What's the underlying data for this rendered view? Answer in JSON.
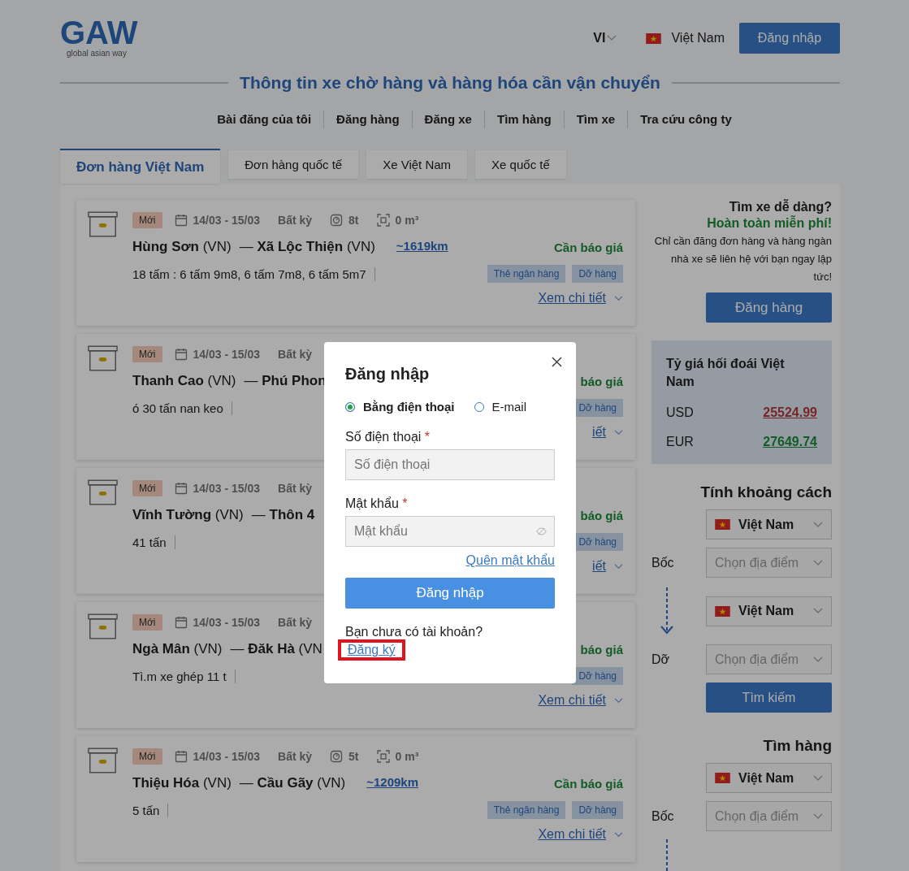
{
  "logo": {
    "name": "GAW",
    "tagline": "global asian way"
  },
  "header": {
    "language": "VI",
    "country": "Việt Nam",
    "login_button": "Đăng nhập"
  },
  "page_title": "Thông tin xe chờ hàng và hàng hóa cần vận chuyển",
  "nav": [
    "Bài đăng của tôi",
    "Đăng hàng",
    "Đăng xe",
    "Tìm hàng",
    "Tìm xe",
    "Tra cứu công ty"
  ],
  "tabs": [
    {
      "label": "Đơn hàng Việt Nam",
      "selected": true
    },
    {
      "label": "Đơn hàng quốc tế",
      "selected": false
    },
    {
      "label": "Xe Việt Nam",
      "selected": false
    },
    {
      "label": "Xe quốc tế",
      "selected": false
    }
  ],
  "orders": [
    {
      "badge": "Mới",
      "date": "14/03 - 15/03",
      "time": "Bất kỳ",
      "weight": "8t",
      "volume": "0 m³",
      "from": "Hùng Sơn",
      "from_country": "(VN)",
      "dash": "—",
      "to": "Xã Lộc Thiện",
      "to_country": "(VN)",
      "distance": "~1619km",
      "price": "Cần báo giá",
      "cargo": "18 tấm : 6 tấm 9m8, 6 tấm 7m8, 6 tấm 5m7",
      "tags": [
        "Thẻ ngân hàng",
        "Dỡ hàng"
      ],
      "details_link": "Xem chi tiết"
    },
    {
      "badge": "Mới",
      "date": "14/03 - 15/03",
      "time": "Bất kỳ",
      "from": "Thanh Cao",
      "from_country": "(VN)",
      "dash": "—",
      "to": "Phú Phon",
      "price": "báo giá",
      "cargo": "ó 30 tấn nan keo",
      "tags": [
        "Dỡ hàng"
      ],
      "details_link": "iết"
    },
    {
      "badge": "Mới",
      "date": "14/03 - 15/03",
      "time": "Bất kỳ",
      "from": "Vĩnh Tường",
      "from_country": "(VN)",
      "dash": "—",
      "to": "Thôn 4",
      "price": "báo giá",
      "cargo": "41 tấn",
      "tags": [
        "Dỡ hàng"
      ],
      "details_link": "iết"
    },
    {
      "badge": "Mới",
      "date": "14/03 - 15/03",
      "time": "Bất kỳ",
      "from": "Ngà Mân",
      "from_country": "(VN)",
      "dash": "—",
      "to": "Đăk Hà",
      "to_country": "(VN",
      "price": "báo giá",
      "cargo": "Tì.m xe ghép 11 t",
      "tags": [
        "Dỡ hàng"
      ],
      "details_link": "Xem chi tiết"
    },
    {
      "badge": "Mới",
      "date": "14/03 - 15/03",
      "time": "Bất kỳ",
      "weight": "5t",
      "volume": "0 m³",
      "from": "Thiệu Hóa",
      "from_country": "(VN)",
      "dash": "—",
      "to": "Cầu Gãy",
      "to_country": "(VN)",
      "distance": "~1209km",
      "price": "Cần báo giá",
      "cargo": "5 tấn",
      "tags": [
        "Thẻ ngân hàng",
        "Dỡ hàng"
      ],
      "details_link": "Xem chi tiết"
    }
  ],
  "promo": {
    "title": "Tìm xe dễ dàng?",
    "highlight": "Hoàn toàn miễn phí!",
    "text": "Chỉ cần đăng đơn hàng và hàng ngàn nhà xe sẽ liên hệ với bạn ngay lập tức!",
    "button": "Đăng hàng"
  },
  "exchange": {
    "title": "Tỷ giá hối đoái Việt Nam",
    "rates": [
      {
        "currency": "USD",
        "value": "25524.99",
        "kind": "down"
      },
      {
        "currency": "EUR",
        "value": "27649.74",
        "kind": "up"
      }
    ]
  },
  "distance": {
    "title": "Tính khoảng cách",
    "pickup_label": "Bốc",
    "drop_label": "Dỡ",
    "pickup_country": "Việt Nam",
    "pickup_placeholder": "Chọn địa điểm",
    "drop_country": "Việt Nam",
    "drop_placeholder": "Chọn địa điểm",
    "button": "Tìm kiếm"
  },
  "find_goods": {
    "title": "Tìm hàng",
    "country": "Việt Nam",
    "label": "Bốc",
    "placeholder": "Chọn địa điểm"
  },
  "login": {
    "title": "Đăng nhập",
    "methods": [
      {
        "label": "Bằng điện thoại",
        "selected": true
      },
      {
        "label": "E-mail",
        "selected": false
      }
    ],
    "phone_label": "Số điện thoại",
    "phone_required": "*",
    "phone_placeholder": "Số điện thoại",
    "password_label": "Mật khẩu",
    "password_required": "*",
    "password_placeholder": "Mật khẩu",
    "forgot": "Quên mật khẩu",
    "submit": "Đăng nhập",
    "no_account": "Bạn chưa có tài khoản?",
    "register": "Đăng ký"
  }
}
